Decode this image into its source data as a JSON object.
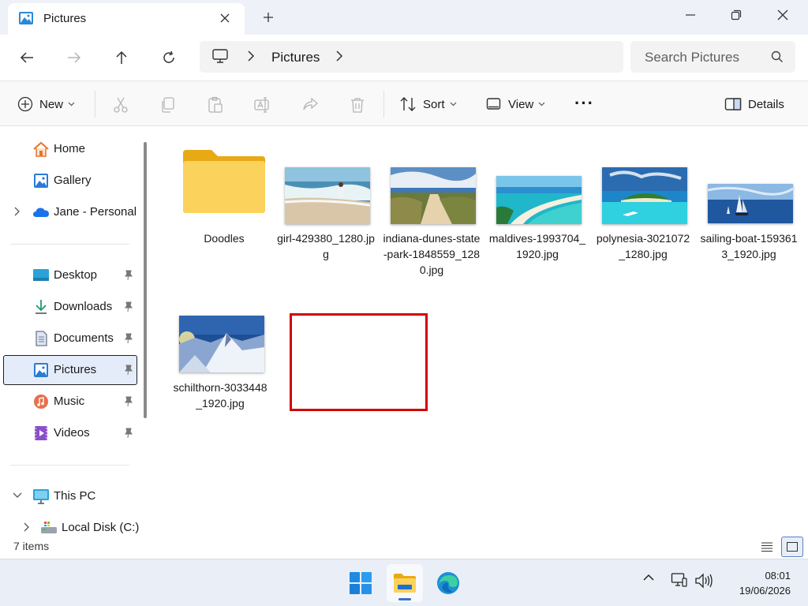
{
  "window": {
    "tab_title": "Pictures",
    "minimize_icon": "minimize-icon",
    "restore_icon": "restore-icon",
    "close_icon": "close-icon"
  },
  "address": {
    "location_icon": "computer-icon",
    "current": "Pictures",
    "search_placeholder": "Search Pictures"
  },
  "commands": {
    "new_label": "New",
    "sort_label": "Sort",
    "view_label": "View",
    "more_label": "···",
    "details_label": "Details"
  },
  "sidebar": {
    "items": [
      {
        "label": "Home",
        "icon": "home-icon"
      },
      {
        "label": "Gallery",
        "icon": "gallery-icon"
      },
      {
        "label": "Jane - Personal",
        "icon": "onedrive-icon"
      },
      {
        "label": "Desktop",
        "icon": "desktop-icon"
      },
      {
        "label": "Downloads",
        "icon": "downloads-icon"
      },
      {
        "label": "Documents",
        "icon": "documents-icon"
      },
      {
        "label": "Pictures",
        "icon": "pictures-icon"
      },
      {
        "label": "Music",
        "icon": "music-icon"
      },
      {
        "label": "Videos",
        "icon": "videos-icon"
      },
      {
        "label": "This PC",
        "icon": "this-pc-icon"
      },
      {
        "label": "Local Disk (C:)",
        "icon": "local-disk-icon"
      }
    ]
  },
  "files": [
    {
      "name": "Doodles",
      "type": "folder"
    },
    {
      "name": "girl-429380_1280.jpg",
      "type": "image"
    },
    {
      "name": "indiana-dunes-state-park-1848559_1280.jpg",
      "type": "image"
    },
    {
      "name": "maldives-1993704_1920.jpg",
      "type": "image"
    },
    {
      "name": "polynesia-3021072_1280.jpg",
      "type": "image"
    },
    {
      "name": "sailing-boat-1593613_1920.jpg",
      "type": "image"
    },
    {
      "name": "schilthorn-3033448_1920.jpg",
      "type": "image"
    }
  ],
  "status": {
    "item_count": "7 items"
  },
  "taskbar": {
    "apps": [
      "start-icon",
      "file-explorer-icon",
      "edge-icon"
    ],
    "time": "08:01",
    "date": "19/06/2026"
  }
}
